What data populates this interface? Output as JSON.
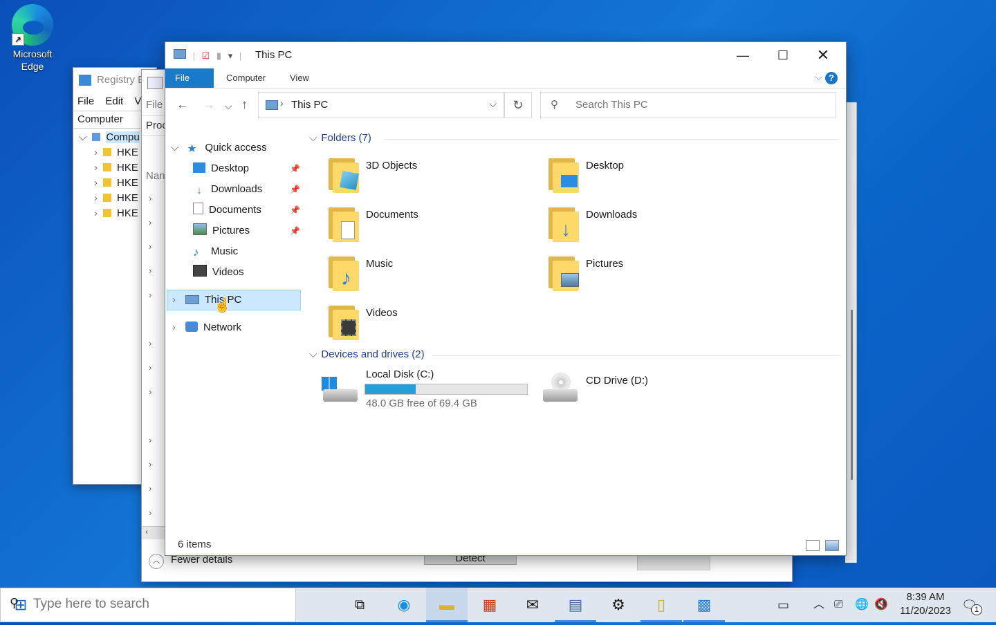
{
  "desktop": {
    "edge_label_1": "Microsoft",
    "edge_label_2": "Edge"
  },
  "regedit": {
    "title": "Registry E",
    "menu": [
      "File",
      "Edit",
      "Vi"
    ],
    "address": "Computer",
    "root": "Compu",
    "keys": [
      "HKE",
      "HKE",
      "HKE",
      "HKE",
      "HKE"
    ]
  },
  "taskmgr": {
    "menu_file": "File",
    "tab_proc": "Proc",
    "col_name": "Nan",
    "fewer_details": "Fewer details",
    "detect": "Detect"
  },
  "explorer": {
    "title": "This PC",
    "ribbon_tabs": {
      "file": "File",
      "computer": "Computer",
      "view": "View"
    },
    "address": "This PC",
    "search_placeholder": "Search This PC",
    "nav": {
      "quick_access": "Quick access",
      "pinned": [
        "Desktop",
        "Downloads",
        "Documents",
        "Pictures"
      ],
      "music": "Music",
      "videos": "Videos",
      "this_pc": "This PC",
      "network": "Network"
    },
    "folders_header": "Folders (7)",
    "folders": [
      "3D Objects",
      "Desktop",
      "Documents",
      "Downloads",
      "Music",
      "Pictures",
      "Videos"
    ],
    "devices_header": "Devices and drives (2)",
    "drives": {
      "c_name": "Local Disk (C:)",
      "c_free": "48.0 GB free of 69.4 GB",
      "c_used_fraction": 0.31,
      "d_name": "CD Drive (D:)"
    },
    "status": "6 items"
  },
  "taskbar": {
    "search_placeholder": "Type here to search",
    "time": "8:39 AM",
    "date": "11/20/2023",
    "notif_count": "1"
  },
  "colors": {
    "accent": "#1979ca",
    "folder": "#fcd968",
    "selection": "#cce8ff",
    "progress": "#26a0da"
  }
}
